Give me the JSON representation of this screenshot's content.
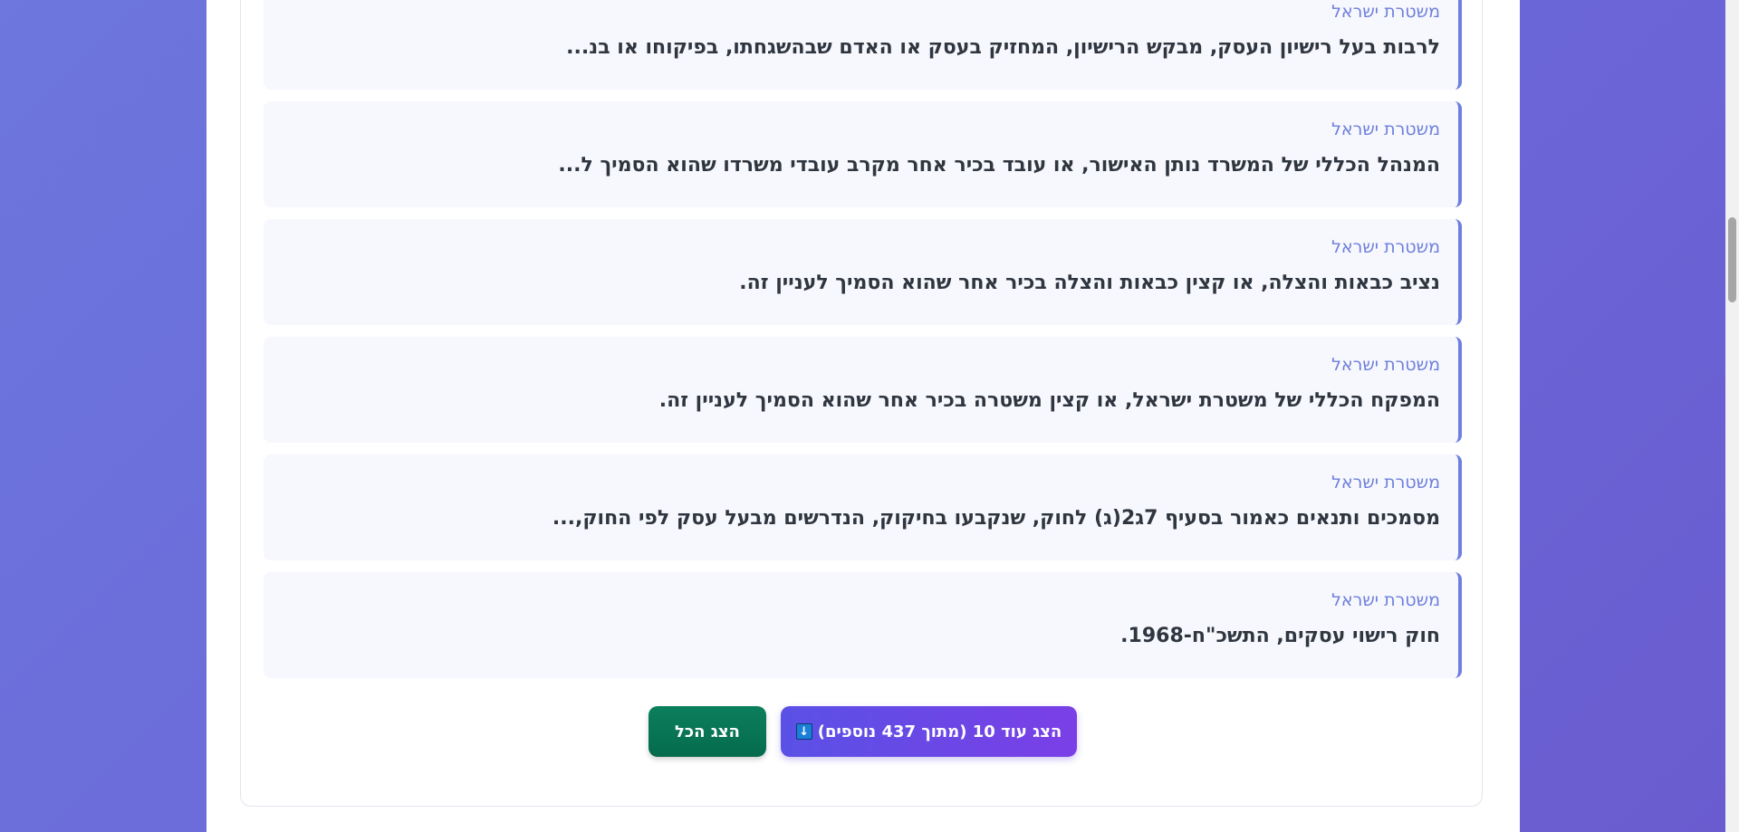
{
  "results": [
    {
      "source": "משטרת ישראל",
      "text": "לרבות בעל רישיון העסק, מבקש הרישיון, המחזיק בעסק או האדם שבהשגחתו, בפיקוחו או בנ..."
    },
    {
      "source": "משטרת ישראל",
      "text": "המנהל הכללי של המשרד נותן האישור, או עובד בכיר אחר מקרב עובדי משרדו שהוא הסמיך ל..."
    },
    {
      "source": "משטרת ישראל",
      "text": "נציב כבאות והצלה, או קצין כבאות והצלה בכיר אחר שהוא הסמיך לעניין זה."
    },
    {
      "source": "משטרת ישראל",
      "text": "המפקח הכללי של משטרת ישראל, או קצין משטרה בכיר אחר שהוא הסמיך לעניין זה."
    },
    {
      "source": "משטרת ישראל",
      "text": "מסמכים ותנאים כאמור בסעיף 7ג2(ג) לחוק, שנקבעו בחיקוק, הנדרשים מבעל עסק לפי החוק,..."
    },
    {
      "source": "משטרת ישראל",
      "text": "חוק רישוי עסקים, התשכ\"ח-1968."
    }
  ],
  "actions": {
    "show_more_label": "הצג עוד 10 (מתוך 437 נוספים)",
    "show_more_icon": "down-arrow-icon",
    "show_all_label": "הצג הכל"
  },
  "colors": {
    "background": "#6b6bd9",
    "accent": "#6e7fe0",
    "show_all": "#056b4c",
    "show_more": "#6a48e6"
  }
}
